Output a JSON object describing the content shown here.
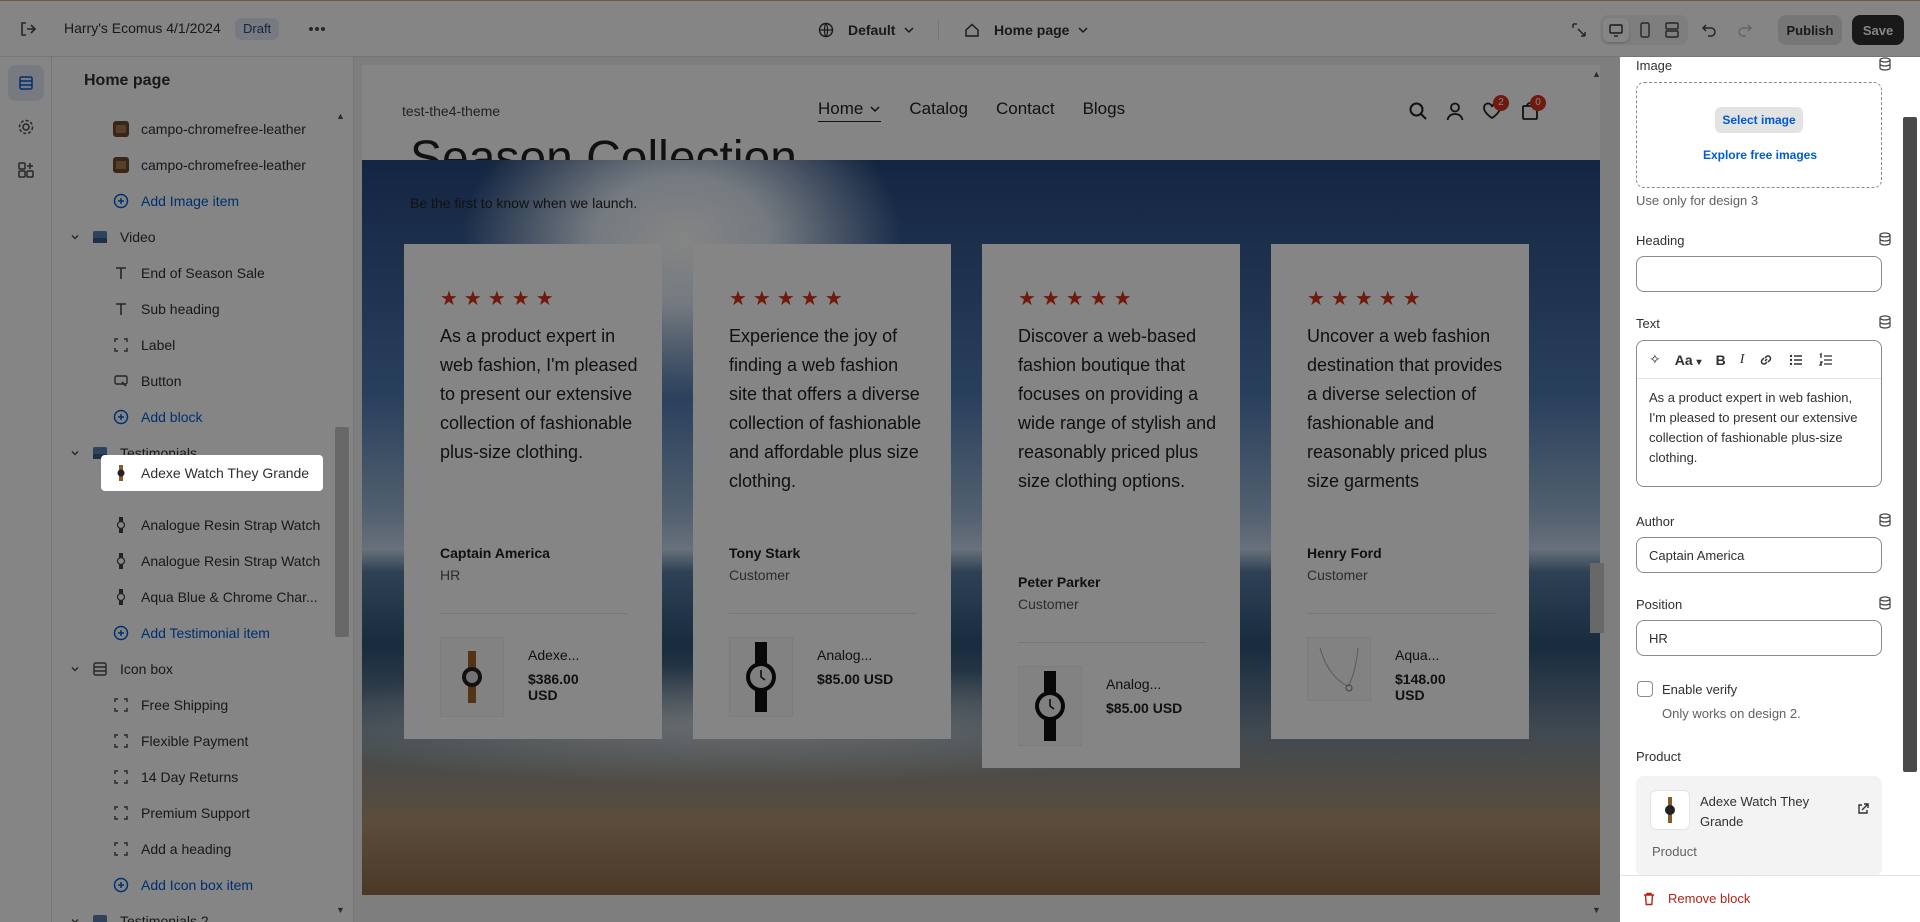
{
  "topbar": {
    "exit_label": "Exit",
    "store_name": "Harry's Ecomus 4/1/2024",
    "status_badge": "Draft",
    "more_label": "More actions",
    "theme_select": "Default",
    "page_select": "Home page",
    "publish_label": "Publish",
    "save_label": "Save"
  },
  "sidebar": {
    "title": "Home page",
    "rows": [
      {
        "label": "campo-chromefree-leather",
        "type": "image"
      },
      {
        "label": "campo-chromefree-leather",
        "type": "image"
      },
      {
        "label": "Add Image item",
        "type": "add"
      },
      {
        "label": "Video",
        "type": "section"
      },
      {
        "label": "End of Season Sale",
        "type": "text"
      },
      {
        "label": "Sub heading",
        "type": "text"
      },
      {
        "label": "Label",
        "type": "block"
      },
      {
        "label": "Button",
        "type": "button"
      },
      {
        "label": "Add block",
        "type": "add"
      },
      {
        "label": "Testimonials",
        "type": "section"
      },
      {
        "label": "Adexe Watch They Grande",
        "type": "selected"
      },
      {
        "label": "Analogue Resin Strap Watch",
        "type": "watch"
      },
      {
        "label": "Analogue Resin Strap Watch",
        "type": "watch"
      },
      {
        "label": "Aqua Blue & Chrome Char...",
        "type": "watch"
      },
      {
        "label": "Add Testimonial item",
        "type": "add"
      },
      {
        "label": "Icon box",
        "type": "section"
      },
      {
        "label": "Free Shipping",
        "type": "block"
      },
      {
        "label": "Flexible Payment",
        "type": "block"
      },
      {
        "label": "14 Day Returns",
        "type": "block"
      },
      {
        "label": "Premium Support",
        "type": "block"
      },
      {
        "label": "Add a heading",
        "type": "block"
      },
      {
        "label": "Add Icon box item",
        "type": "add"
      },
      {
        "label": "Testimonials 2",
        "type": "section"
      }
    ]
  },
  "preview": {
    "store_logo": "test-the4-theme",
    "nav": [
      "Home",
      "Catalog",
      "Contact",
      "Blogs"
    ],
    "wishlist_count": "2",
    "cart_count": "0",
    "section_title": "Season Collection",
    "section_subtitle": "Be the first to know when we launch.",
    "stars": "★★★★★",
    "cards": [
      {
        "quote": "As a product expert in web fashion, I'm pleased to present our extensive collection of fashionable plus-size clothing.",
        "author": "Captain America",
        "role": "HR",
        "product": "Adexe...",
        "price": "$386.00 USD",
        "thumb": "watch-brown"
      },
      {
        "quote": "Experience the joy of finding a web fashion site that offers a diverse collection of fashionable and affordable plus size clothing.",
        "author": "Tony Stark",
        "role": "Customer",
        "product": "Analog...",
        "price": "$85.00 USD",
        "thumb": "watch-black"
      },
      {
        "quote": "Discover a web-based fashion boutique that focuses on providing a wide range of stylish and reasonably priced plus size clothing options.",
        "author": "Peter Parker",
        "role": "Customer",
        "product": "Analog...",
        "price": "$85.00 USD",
        "thumb": "watch-black"
      },
      {
        "quote": "Uncover a web fashion destination that provides a diverse selection of fashionable and reasonably priced plus size garments",
        "author": "Henry Ford",
        "role": "Customer",
        "product": "Aqua...",
        "price": "$148.00 USD",
        "thumb": "necklace"
      }
    ]
  },
  "settings": {
    "image_label": "Image",
    "select_image": "Select image",
    "explore_images": "Explore free images",
    "image_help": "Use only for design 3",
    "heading_label": "Heading",
    "heading_value": "",
    "text_label": "Text",
    "text_value": "As a product expert in web fashion, I'm pleased to present our extensive collection of fashionable plus-size clothing.",
    "author_label": "Author",
    "author_value": "Captain America",
    "position_label": "Position",
    "position_value": "HR",
    "verify_label": "Enable verify",
    "verify_help": "Only works on design 2.",
    "verify_checked": false,
    "product_label": "Product",
    "product_name": "Adexe Watch They Grande",
    "product_caption": "Product",
    "remove_label": "Remove block"
  },
  "colors": {
    "accent": "#005bd3",
    "star": "#d6301a",
    "badge_bg": "#e4ecf7",
    "save_bg": "#303030"
  }
}
